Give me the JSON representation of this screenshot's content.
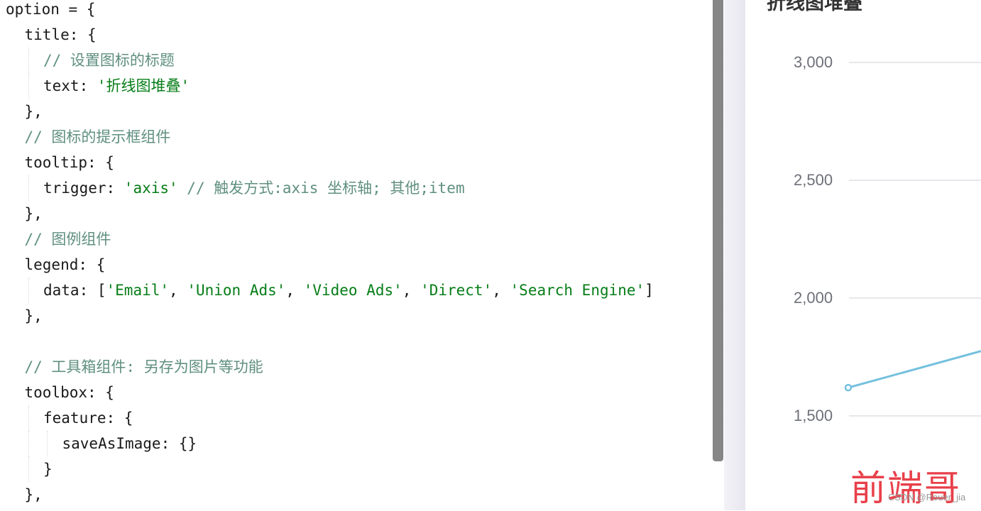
{
  "editor": {
    "lines": [
      {
        "indent": 0,
        "tokens": [
          [
            "plain",
            "option = {"
          ]
        ]
      },
      {
        "indent": 1,
        "tokens": [
          [
            "plain",
            "title: {"
          ]
        ]
      },
      {
        "indent": 2,
        "tokens": [
          [
            "com",
            "// 设置图标的标题"
          ]
        ]
      },
      {
        "indent": 2,
        "tokens": [
          [
            "plain",
            "text: "
          ],
          [
            "str",
            "'折线图堆叠'"
          ]
        ]
      },
      {
        "indent": 1,
        "tokens": [
          [
            "plain",
            "},"
          ]
        ]
      },
      {
        "indent": 1,
        "tokens": [
          [
            "com",
            "// 图标的提示框组件"
          ]
        ]
      },
      {
        "indent": 1,
        "tokens": [
          [
            "plain",
            "tooltip: {"
          ]
        ]
      },
      {
        "indent": 2,
        "tokens": [
          [
            "plain",
            "trigger: "
          ],
          [
            "str",
            "'axis'"
          ],
          [
            "com",
            " // 触发方式:axis 坐标轴; 其他;item"
          ]
        ]
      },
      {
        "indent": 1,
        "tokens": [
          [
            "plain",
            "},"
          ]
        ]
      },
      {
        "indent": 1,
        "tokens": [
          [
            "com",
            "// 图例组件"
          ]
        ]
      },
      {
        "indent": 1,
        "tokens": [
          [
            "plain",
            "legend: {"
          ]
        ]
      },
      {
        "indent": 2,
        "tokens": [
          [
            "plain",
            "data: ["
          ],
          [
            "str",
            "'Email'"
          ],
          [
            "plain",
            ", "
          ],
          [
            "str",
            "'Union Ads'"
          ],
          [
            "plain",
            ", "
          ],
          [
            "str",
            "'Video Ads'"
          ],
          [
            "plain",
            ", "
          ],
          [
            "str",
            "'Direct'"
          ],
          [
            "plain",
            ", "
          ],
          [
            "str",
            "'Search Engine'"
          ],
          [
            "plain",
            "]"
          ]
        ]
      },
      {
        "indent": 1,
        "tokens": [
          [
            "plain",
            "},"
          ]
        ]
      },
      {
        "indent": 0,
        "tokens": []
      },
      {
        "indent": 1,
        "tokens": [
          [
            "com",
            "// 工具箱组件: 另存为图片等功能"
          ]
        ]
      },
      {
        "indent": 1,
        "tokens": [
          [
            "plain",
            "toolbox: {"
          ]
        ]
      },
      {
        "indent": 2,
        "tokens": [
          [
            "plain",
            "feature: {"
          ]
        ]
      },
      {
        "indent": 3,
        "tokens": [
          [
            "plain",
            "saveAsImage: {}"
          ]
        ]
      },
      {
        "indent": 2,
        "tokens": [
          [
            "plain",
            "}"
          ]
        ]
      },
      {
        "indent": 1,
        "tokens": [
          [
            "plain",
            "},"
          ]
        ]
      }
    ]
  },
  "chart_data": {
    "type": "line",
    "title": "折线图堆叠",
    "ylim": [
      1500,
      3000
    ],
    "yticks": [
      "3,000",
      "2,500",
      "2,000",
      "1,500"
    ],
    "ytick_values": [
      3000,
      2500,
      2000,
      1500
    ],
    "grid": true,
    "series": [
      {
        "color": "#73c0de",
        "values": [
          1620,
          1775
        ]
      }
    ]
  },
  "watermark": {
    "logo": "前端哥",
    "credit": "CSDN @Rouer_jia"
  }
}
